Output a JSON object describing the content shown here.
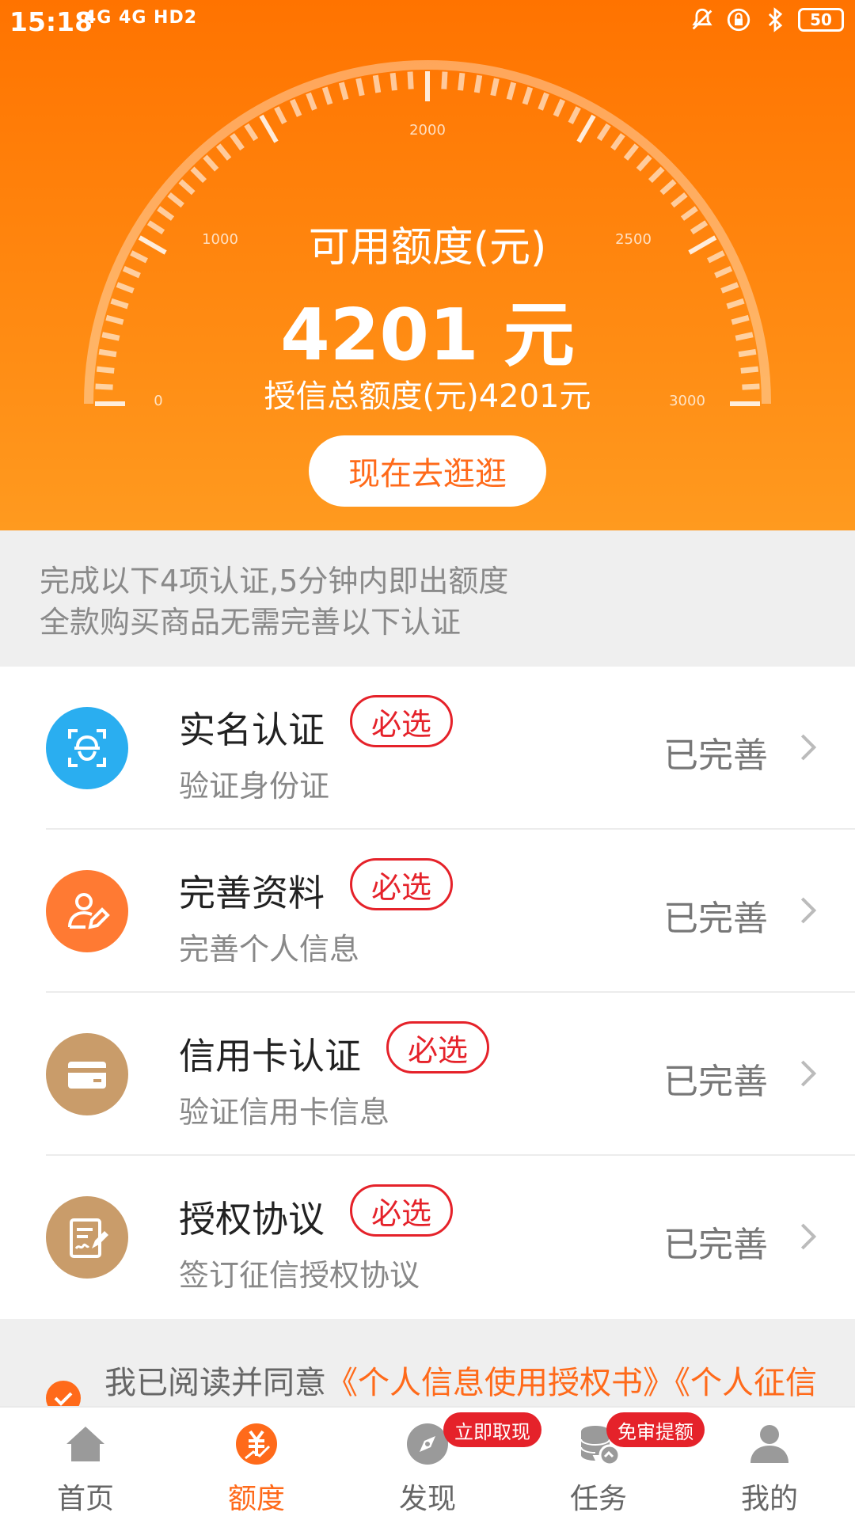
{
  "status_bar": {
    "time": "15:18",
    "network": "4G 4G HD2",
    "battery": "50"
  },
  "gauge": {
    "ticks": [
      "0",
      "1000",
      "2000",
      "2500",
      "3000"
    ],
    "quota_label": "可用额度(元)",
    "quota_value": "4201 元",
    "total_text": "授信总额度(元)4201元",
    "button_label": "现在去逛逛"
  },
  "notice": {
    "line1": "完成以下4项认证,5分钟内即出额度",
    "line2": "全款购买商品无需完善以下认证"
  },
  "list": [
    {
      "icon": "face-scan-icon",
      "title": "实名认证",
      "badge": "必选",
      "subtitle": "验证身份证",
      "status": "已完善",
      "color": "#2aaef0"
    },
    {
      "icon": "profile-edit-icon",
      "title": "完善资料",
      "badge": "必选",
      "subtitle": "完善个人信息",
      "status": "已完善",
      "color": "#ff7a33"
    },
    {
      "icon": "credit-card-icon",
      "title": "信用卡认证",
      "badge": "必选",
      "subtitle": "验证信用卡信息",
      "status": "已完善",
      "color": "#c99c6a"
    },
    {
      "icon": "contract-sign-icon",
      "title": "授权协议",
      "badge": "必选",
      "subtitle": "签订征信授权协议",
      "status": "已完善",
      "color": "#c99c6a"
    }
  ],
  "agreement": {
    "prefix": "我已阅读并同意",
    "link1": "《个人信息使用授权书》",
    "link2": "《个人征信"
  },
  "bottom_nav": [
    {
      "label": "首页",
      "icon": "home-icon",
      "active": false
    },
    {
      "label": "额度",
      "icon": "quota-icon",
      "active": true
    },
    {
      "label": "发现",
      "icon": "discover-icon",
      "active": false,
      "badge": "立即取现"
    },
    {
      "label": "任务",
      "icon": "task-icon",
      "active": false,
      "badge": "免审提额"
    },
    {
      "label": "我的",
      "icon": "profile-icon",
      "active": false
    }
  ],
  "colors": {
    "brand_orange": "#ff6a1a",
    "badge_red": "#e5222a"
  }
}
